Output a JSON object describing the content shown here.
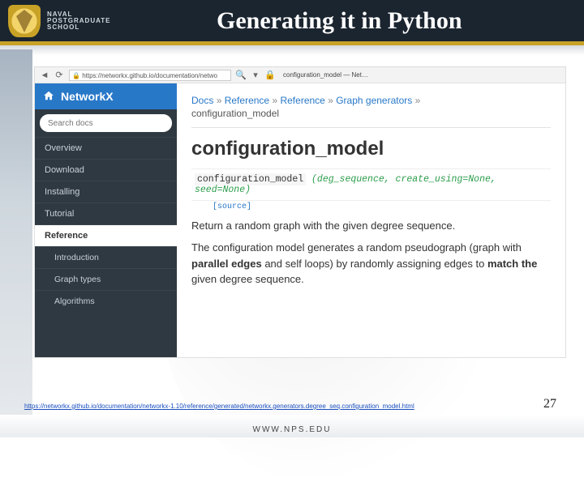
{
  "slide": {
    "title": "Generating it in Python",
    "page_number": "27",
    "footer_site": "WWW.NPS.EDU",
    "footer_url": "https://networkx.github.io/documentation/networkx-1.10/reference/generated/networkx.generators.degree_seq.configuration_model.html"
  },
  "institution": {
    "line1": "NAVAL",
    "line2": "POSTGRADUATE",
    "line3": "SCHOOL"
  },
  "browser": {
    "url_display": "https://networkx.github.io/documentation/netwo",
    "tab_label": "configuration_model — Net…",
    "search_glyph": "🔍",
    "lock_glyph": "🔒",
    "reload_glyph": "⟳",
    "dropdown_glyph": "▾"
  },
  "sidebar": {
    "brand": "NetworkX",
    "search_placeholder": "Search docs",
    "items": [
      "Overview",
      "Download",
      "Installing",
      "Tutorial",
      "Reference"
    ],
    "active_index": 4,
    "subitems": [
      "Introduction",
      "Graph types",
      "Algorithms"
    ]
  },
  "breadcrumb": {
    "items": [
      "Docs",
      "Reference",
      "Reference",
      "Graph generators"
    ],
    "current": "configuration_model",
    "sep": "»"
  },
  "page": {
    "heading": "configuration_model",
    "func_name": "configuration_model",
    "func_args": "(deg_sequence, create_using=None, seed=None)",
    "source_label": "[source]",
    "lead": "Return a random graph with the given degree sequence.",
    "body_pre": "The configuration model generates a random pseudograph (graph with ",
    "body_b1": "parallel edges",
    "body_mid1": " and self loops) by randomly assigning edges to ",
    "body_b2": "match the",
    "body_mid2": " given degree sequence."
  }
}
